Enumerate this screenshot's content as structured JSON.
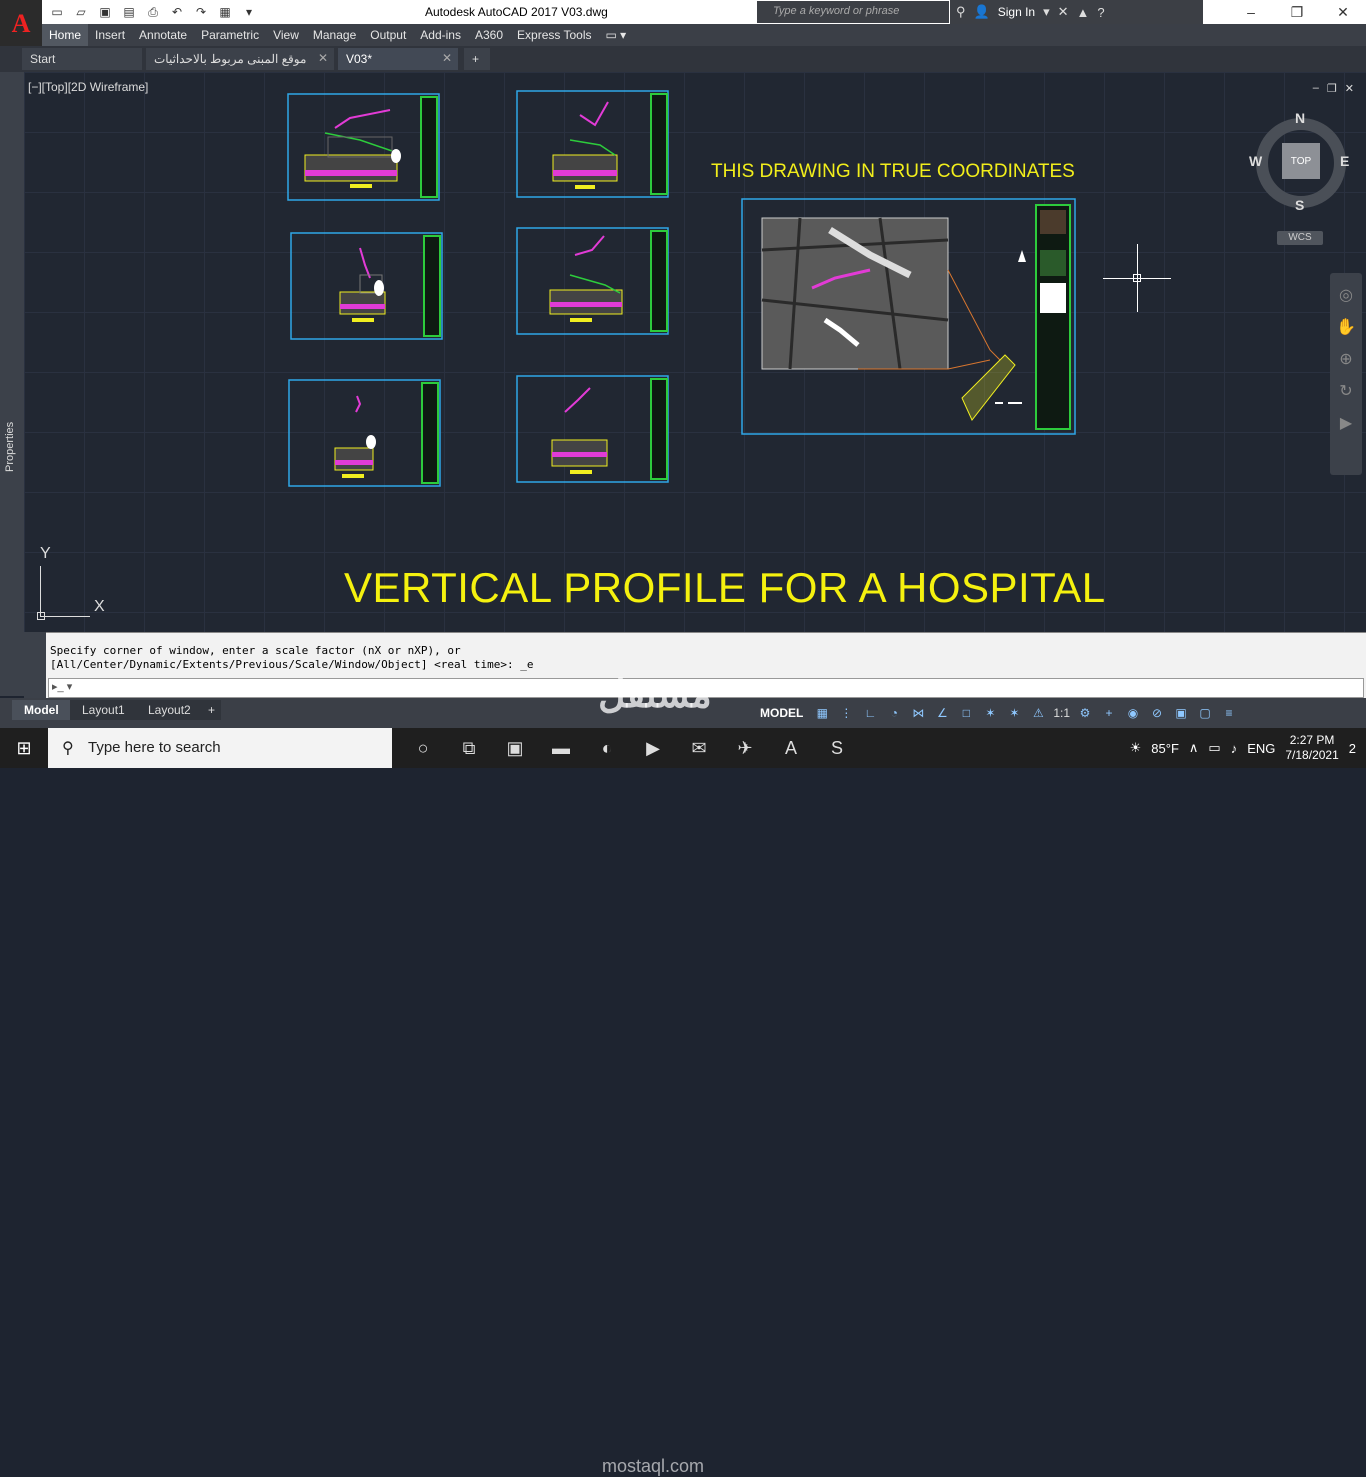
{
  "app": {
    "logo": "A",
    "title": "Autodesk AutoCAD 2017    V03.dwg",
    "search_placeholder": "Type a keyword or phrase",
    "sign_in": "Sign In"
  },
  "ribbon": {
    "tabs": [
      "Home",
      "Insert",
      "Annotate",
      "Parametric",
      "View",
      "Manage",
      "Output",
      "Add-ins",
      "A360",
      "Express Tools"
    ]
  },
  "doc_tabs": {
    "start": "Start",
    "file1": "موقع المبنى مربوط بالاحداثيات",
    "file2": "V03*",
    "add": "+"
  },
  "viewport": {
    "label": "[−][Top][2D Wireframe]",
    "coords_note": "THIS DRAWING IN TRUE COORDINATES",
    "main_title": "VERTICAL PROFILE FOR A HOSPITAL"
  },
  "viewcube": {
    "top": "TOP",
    "n": "N",
    "s": "S",
    "e": "E",
    "w": "W",
    "wcs": "WCS"
  },
  "properties_label": "Properties",
  "ucs": {
    "y": "Y",
    "x": "X"
  },
  "command": {
    "line1": "Specify corner of window, enter a scale factor (nX or nXP), or",
    "line2": "[All/Center/Dynamic/Extents/Previous/Scale/Window/Object] <real time>: _e"
  },
  "layout_tabs": {
    "model": "Model",
    "layout1": "Layout1",
    "layout2": "Layout2",
    "add": "+"
  },
  "status": {
    "model": "MODEL",
    "scale": "1:1"
  },
  "taskbar": {
    "search": "Type here to search",
    "weather": "85°F",
    "lang": "ENG",
    "time": "2:27 PM",
    "date": "7/18/2021",
    "notifications": "2"
  },
  "watermark": {
    "arabic": "مستقل",
    "latin": "mostaql.com"
  },
  "colors": {
    "accent_yellow": "#f5f10f",
    "sheet_blue": "#2fa7e8",
    "titleblock_green": "#2dcc3c",
    "magenta": "#e23bd6"
  }
}
